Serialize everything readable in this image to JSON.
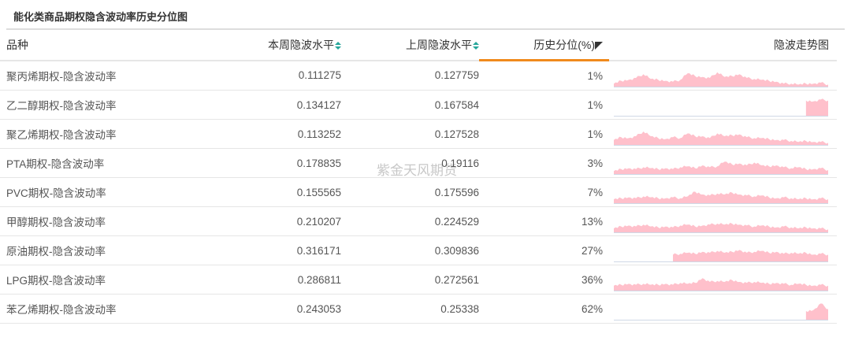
{
  "title": "能化类商品期权隐含波动率历史分位图",
  "watermark": "紫金天风期货",
  "headers": [
    "品种",
    "本周隐波水平",
    "上周隐波水平",
    "历史分位(%)",
    "隐波走势图"
  ],
  "colors": {
    "spark": "#ffc0cb",
    "sort": "#26a69a",
    "active": "#f08a1c"
  },
  "rows": [
    {
      "name": "聚丙烯期权-隐含波动率",
      "cur": "0.111275",
      "prev": "0.127759",
      "pct": "1%",
      "spark": [
        0.2,
        0.35,
        0.4,
        0.5,
        0.7,
        0.45,
        0.4,
        0.35,
        0.3,
        0.4,
        0.75,
        0.6,
        0.55,
        0.5,
        0.8,
        0.55,
        0.6,
        0.7,
        0.5,
        0.45,
        0.4,
        0.35,
        0.3,
        0.2,
        0.2,
        0.15,
        0.2,
        0.2,
        0.25,
        0.15
      ]
    },
    {
      "name": "乙二醇期权-隐含波动率",
      "cur": "0.134127",
      "prev": "0.167584",
      "pct": "1%",
      "spark": [
        null,
        null,
        null,
        null,
        null,
        null,
        null,
        null,
        null,
        null,
        null,
        null,
        null,
        null,
        null,
        null,
        null,
        null,
        null,
        null,
        null,
        null,
        null,
        null,
        null,
        null,
        0.85,
        0.8,
        0.9,
        0.85
      ]
    },
    {
      "name": "聚乙烯期权-隐含波动率",
      "cur": "0.113252",
      "prev": "0.127528",
      "pct": "1%",
      "spark": [
        0.3,
        0.45,
        0.4,
        0.5,
        0.75,
        0.5,
        0.4,
        0.35,
        0.45,
        0.4,
        0.65,
        0.5,
        0.5,
        0.4,
        0.65,
        0.5,
        0.55,
        0.6,
        0.45,
        0.4,
        0.4,
        0.35,
        0.3,
        0.3,
        0.25,
        0.2,
        0.25,
        0.2,
        0.2,
        0.15
      ]
    },
    {
      "name": "PTA期权-隐含波动率",
      "cur": "0.178835",
      "prev": "0.19116",
      "pct": "3%",
      "spark": [
        0.2,
        0.3,
        0.35,
        0.3,
        0.4,
        0.35,
        0.3,
        0.35,
        0.3,
        0.4,
        0.45,
        0.35,
        0.5,
        0.4,
        0.45,
        0.7,
        0.55,
        0.6,
        0.5,
        0.65,
        0.5,
        0.45,
        0.5,
        0.4,
        0.35,
        0.4,
        0.3,
        0.3,
        0.35,
        0.25
      ]
    },
    {
      "name": "PVC期权-隐含波动率",
      "cur": "0.155565",
      "prev": "0.175596",
      "pct": "7%",
      "spark": [
        0.25,
        0.3,
        0.35,
        0.3,
        0.4,
        0.35,
        0.3,
        0.3,
        0.35,
        0.3,
        0.4,
        0.65,
        0.5,
        0.45,
        0.55,
        0.5,
        0.6,
        0.5,
        0.45,
        0.4,
        0.45,
        0.35,
        0.3,
        0.35,
        0.3,
        0.25,
        0.3,
        0.25,
        0.3,
        0.25
      ]
    },
    {
      "name": "甲醇期权-隐含波动率",
      "cur": "0.210207",
      "prev": "0.224529",
      "pct": "13%",
      "spark": [
        0.25,
        0.35,
        0.4,
        0.35,
        0.45,
        0.35,
        0.3,
        0.35,
        0.3,
        0.4,
        0.45,
        0.35,
        0.4,
        0.45,
        0.5,
        0.45,
        0.5,
        0.45,
        0.4,
        0.35,
        0.4,
        0.35,
        0.3,
        0.35,
        0.3,
        0.25,
        0.3,
        0.25,
        0.25,
        0.2
      ]
    },
    {
      "name": "原油期权-隐含波动率",
      "cur": "0.316171",
      "prev": "0.309836",
      "pct": "27%",
      "spark": [
        null,
        null,
        null,
        null,
        null,
        null,
        null,
        null,
        0.4,
        0.45,
        0.5,
        0.45,
        0.55,
        0.5,
        0.6,
        0.5,
        0.55,
        0.65,
        0.5,
        0.55,
        0.6,
        0.5,
        0.55,
        0.45,
        0.5,
        0.45,
        0.5,
        0.4,
        0.45,
        0.4
      ]
    },
    {
      "name": "LPG期权-隐含波动率",
      "cur": "0.286811",
      "prev": "0.272561",
      "pct": "36%",
      "spark": [
        0.3,
        0.35,
        0.4,
        0.35,
        0.4,
        0.35,
        0.35,
        0.4,
        0.35,
        0.45,
        0.4,
        0.45,
        0.7,
        0.5,
        0.55,
        0.5,
        0.6,
        0.5,
        0.45,
        0.5,
        0.45,
        0.4,
        0.45,
        0.4,
        0.35,
        0.4,
        0.35,
        0.3,
        0.35,
        0.3
      ]
    },
    {
      "name": "苯乙烯期权-隐含波动率",
      "cur": "0.243053",
      "prev": "0.25338",
      "pct": "62%",
      "spark": [
        null,
        null,
        null,
        null,
        null,
        null,
        null,
        null,
        null,
        null,
        null,
        null,
        null,
        null,
        null,
        null,
        null,
        null,
        null,
        null,
        null,
        null,
        null,
        null,
        null,
        null,
        0.5,
        0.55,
        0.9,
        0.6
      ]
    }
  ]
}
